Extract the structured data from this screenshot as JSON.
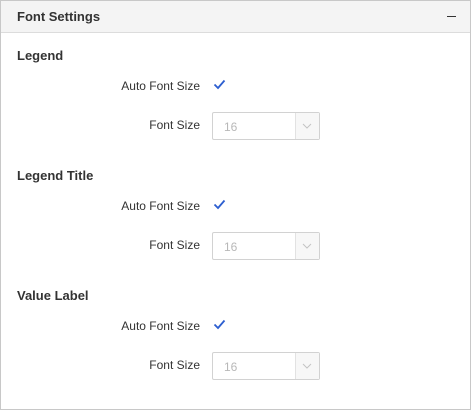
{
  "panel": {
    "title": "Font Settings",
    "collapse_icon": "minus-icon"
  },
  "sections": [
    {
      "title": "Legend",
      "auto_font_size_label": "Auto Font Size",
      "auto_font_size_checked": true,
      "font_size_label": "Font Size",
      "font_size_value": "16"
    },
    {
      "title": "Legend Title",
      "auto_font_size_label": "Auto Font Size",
      "auto_font_size_checked": true,
      "font_size_label": "Font Size",
      "font_size_value": "16"
    },
    {
      "title": "Value Label",
      "auto_font_size_label": "Auto Font Size",
      "auto_font_size_checked": true,
      "font_size_label": "Font Size",
      "font_size_value": "16"
    }
  ],
  "colors": {
    "check": "#2d5fd0",
    "disabled_text": "#b8b8b8"
  }
}
